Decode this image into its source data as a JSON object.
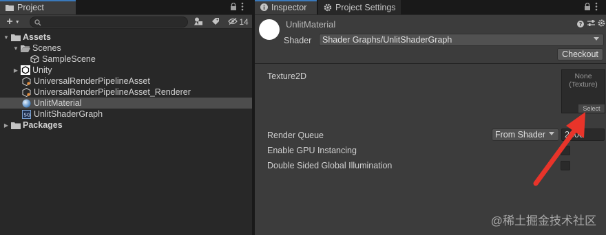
{
  "left_tabs": {
    "project": "Project"
  },
  "left_toolbar": {
    "add": "+",
    "hidden_count": "14"
  },
  "tree": [
    {
      "label": "Assets",
      "arrow": "▼",
      "bold": true
    },
    {
      "label": "Scenes",
      "arrow": "▼"
    },
    {
      "label": "SampleScene",
      "arrow": ""
    },
    {
      "label": "Unity",
      "arrow": "▶"
    },
    {
      "label": "UniversalRenderPipelineAsset",
      "arrow": ""
    },
    {
      "label": "UniversalRenderPipelineAsset_Renderer",
      "arrow": ""
    },
    {
      "label": "UnlitMaterial",
      "arrow": "",
      "selected": true
    },
    {
      "label": "UnlitShaderGraph",
      "arrow": ""
    },
    {
      "label": "Packages",
      "arrow": "▶",
      "bold": true
    }
  ],
  "right_tabs": {
    "inspector": "Inspector",
    "project_settings": "Project Settings"
  },
  "inspector": {
    "material_name": "UnlitMaterial",
    "shader_label": "Shader",
    "shader_value": "Shader Graphs/UnlitShaderGraph",
    "checkout": "Checkout",
    "texture_label": "Texture2D",
    "texture_none": "None",
    "texture_type": "(Texture)",
    "texture_select": "Select",
    "render_queue_label": "Render Queue",
    "render_queue_mode": "From Shader",
    "render_queue_value": "2000",
    "gpu_instancing_label": "Enable GPU Instancing",
    "double_sided_gi_label": "Double Sided Global Illumination"
  },
  "watermark": "@稀土掘金技术社区",
  "colors": {
    "accent_blue": "#3a79bb",
    "annotation_arrow": "#e8342a"
  }
}
